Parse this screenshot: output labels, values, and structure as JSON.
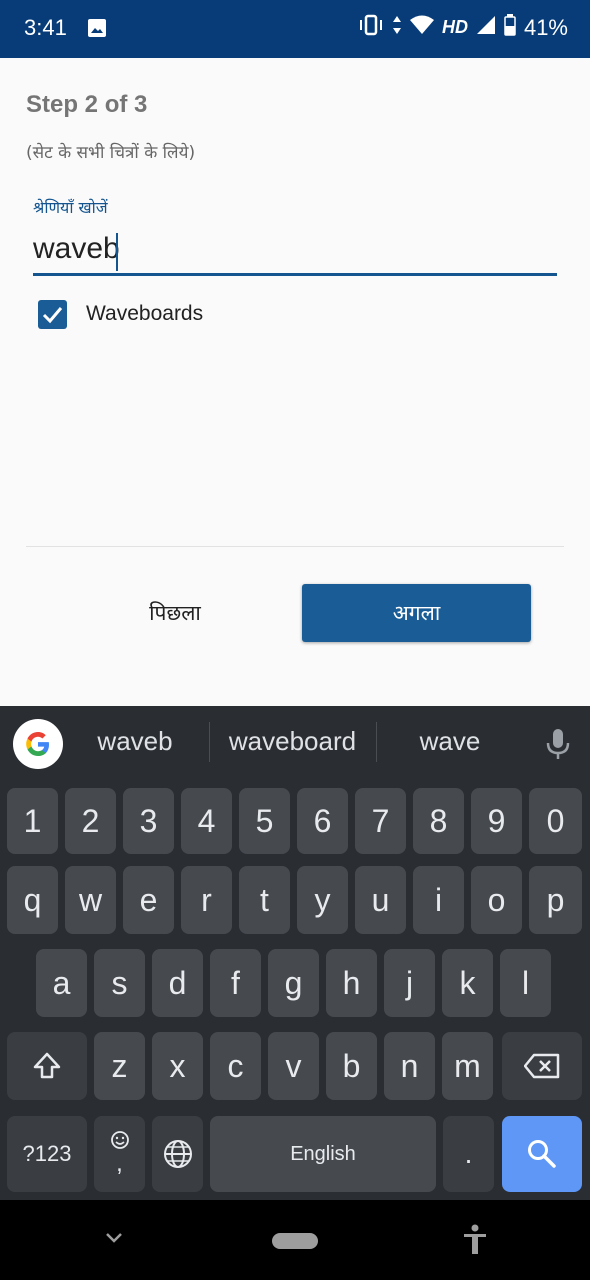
{
  "status_bar": {
    "time": "3:41",
    "network": "HD",
    "battery": "41%"
  },
  "wizard": {
    "step_title": "Step 2 of 3",
    "subtitle": "(सेट के सभी चित्रों के लिये)",
    "search_label": "श्रेणियाँ खोजें",
    "search_value": "waveb",
    "checkbox_label": "Waveboards",
    "checkbox_checked": true,
    "back_label": "पिछला",
    "next_label": "अगला"
  },
  "keyboard": {
    "suggestions": [
      "waveb",
      "waveboard",
      "wave"
    ],
    "row_numbers": [
      "1",
      "2",
      "3",
      "4",
      "5",
      "6",
      "7",
      "8",
      "9",
      "0"
    ],
    "row_top": [
      "q",
      "w",
      "e",
      "r",
      "t",
      "y",
      "u",
      "i",
      "o",
      "p"
    ],
    "row_middle": [
      "a",
      "s",
      "d",
      "f",
      "g",
      "h",
      "j",
      "k",
      "l"
    ],
    "row_bottom": [
      "z",
      "x",
      "c",
      "v",
      "b",
      "n",
      "m"
    ],
    "symbols_label": "?123",
    "comma_label": ",",
    "space_label": "English",
    "period_label": ".",
    "accent_color": "#5e97f6"
  },
  "colors": {
    "status_bar": "#073c79",
    "primary": "#1a5d96"
  }
}
